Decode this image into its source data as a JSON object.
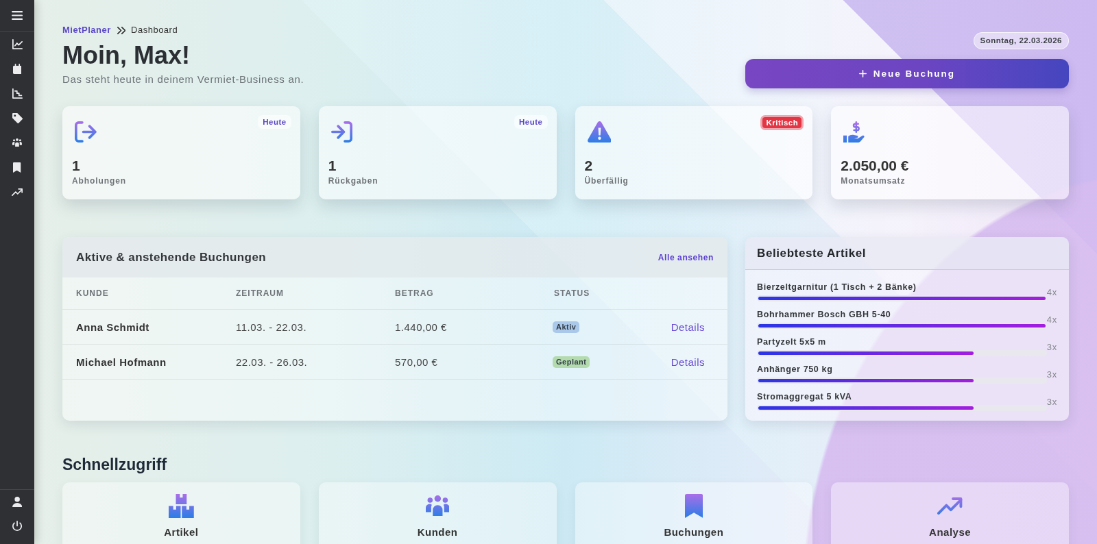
{
  "sidebar": {
    "items": [
      {
        "kind": "dashboard"
      },
      {
        "kind": "calendar"
      },
      {
        "kind": "reports"
      },
      {
        "kind": "prices"
      },
      {
        "kind": "customers"
      },
      {
        "kind": "bookings"
      },
      {
        "kind": "analytics"
      }
    ],
    "footer_items": [
      {
        "kind": "profile"
      },
      {
        "kind": "logout"
      }
    ]
  },
  "header": {
    "breadcrumb": [
      "MietPlaner",
      "Dashboard"
    ],
    "title": "Moin, Max!",
    "subtitle": "Das steht heute in deinem Vermiet-Business an.",
    "date": "Sonntag, 22.03.2026",
    "new_booking_button": "Neue Buchung"
  },
  "stats": [
    {
      "kind": "pickups",
      "value": "1",
      "label": "Abholungen",
      "badge": {
        "label": "Heute",
        "kind": "info"
      }
    },
    {
      "kind": "returns",
      "value": "1",
      "label": "Rückgaben",
      "badge": {
        "label": "Heute",
        "kind": "info"
      }
    },
    {
      "kind": "overdue",
      "value": "2",
      "label": "Überfällig",
      "badge": {
        "label": "Kritisch",
        "kind": "critical"
      }
    },
    {
      "kind": "revenue",
      "value": "2.050,00 €",
      "label": "Monatsumsatz"
    }
  ],
  "bookings": {
    "title": "Aktive & anstehende Buchungen",
    "view_all_link": "Alle ansehen",
    "columns": [
      "KUNDE",
      "ZEITRAUM",
      "BETRAG",
      "STATUS"
    ],
    "rows": [
      {
        "customer": "Anna Schmidt",
        "period": "11.03. - 22.03.",
        "amount": "1.440,00 €",
        "status": {
          "label": "Aktiv",
          "color": "#a9c8ea"
        },
        "action": "Details"
      },
      {
        "customer": "Michael Hofmann",
        "period": "22.03. - 26.03.",
        "amount": "570,00 €",
        "status": {
          "label": "Geplant",
          "color": "#b3dbae"
        },
        "action": "Details"
      }
    ]
  },
  "popular_items": {
    "title": "Beliebteste Artikel",
    "items": [
      {
        "name": "Bierzeltgarnitur (1 Tisch + 2 Bänke)",
        "count": "4x",
        "level": 1
      },
      {
        "name": "Bohrhammer Bosch GBH 5-40",
        "count": "4x",
        "level": 1
      },
      {
        "name": "Partyzelt 5x5 m",
        "count": "3x",
        "level": 0.75
      },
      {
        "name": "Anhänger 750 kg",
        "count": "3x",
        "level": 0.75
      },
      {
        "name": "Stromaggregat 5 kVA",
        "count": "3x",
        "level": 0.75
      }
    ]
  },
  "quick_access": {
    "title": "Schnellzugriff",
    "items": [
      {
        "kind": "articles",
        "label": "Artikel"
      },
      {
        "kind": "customers",
        "label": "Kunden"
      },
      {
        "kind": "bookings",
        "label": "Buchungen"
      },
      {
        "kind": "analytics",
        "label": "Analyse"
      }
    ]
  }
}
